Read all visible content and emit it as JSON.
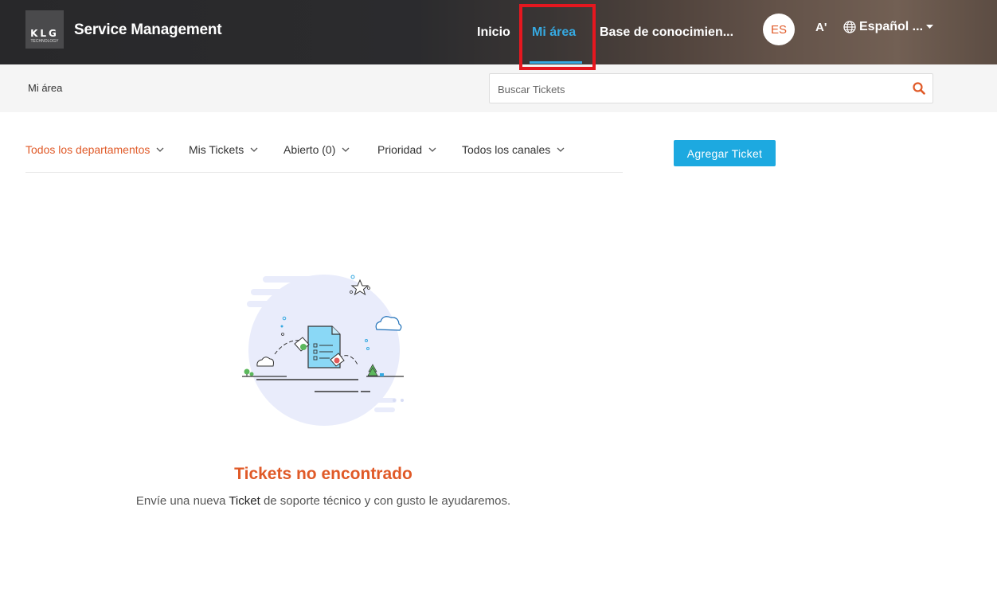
{
  "header": {
    "logo_text": "KLG",
    "logo_subtext": "TECHNOLOGY",
    "brand": "Service Management",
    "nav": [
      {
        "label": "Inicio"
      },
      {
        "label": "Mi área"
      },
      {
        "label": "Base de conocimien..."
      }
    ],
    "avatar": "ES",
    "font_size_icon": "A'",
    "language": "Español ...",
    "accent_color": "#36a9e1",
    "highlight_color": "#e5171f"
  },
  "subbar": {
    "breadcrumb": "Mi área",
    "search_placeholder": "Buscar Tickets"
  },
  "filters": [
    {
      "label": "Todos los departamentos"
    },
    {
      "label": "Mis Tickets"
    },
    {
      "label": "Abierto (0)"
    },
    {
      "label": "Prioridad"
    },
    {
      "label": "Todos los canales"
    }
  ],
  "add_button": "Agregar Ticket",
  "empty_state": {
    "title": "Tickets no encontrado",
    "desc_before": "Envíe una nueva ",
    "desc_link": "Ticket",
    "desc_after": " de soporte técnico y con gusto le ayudaremos."
  },
  "colors": {
    "orange": "#e05a28",
    "button_blue": "#1da9e0"
  }
}
